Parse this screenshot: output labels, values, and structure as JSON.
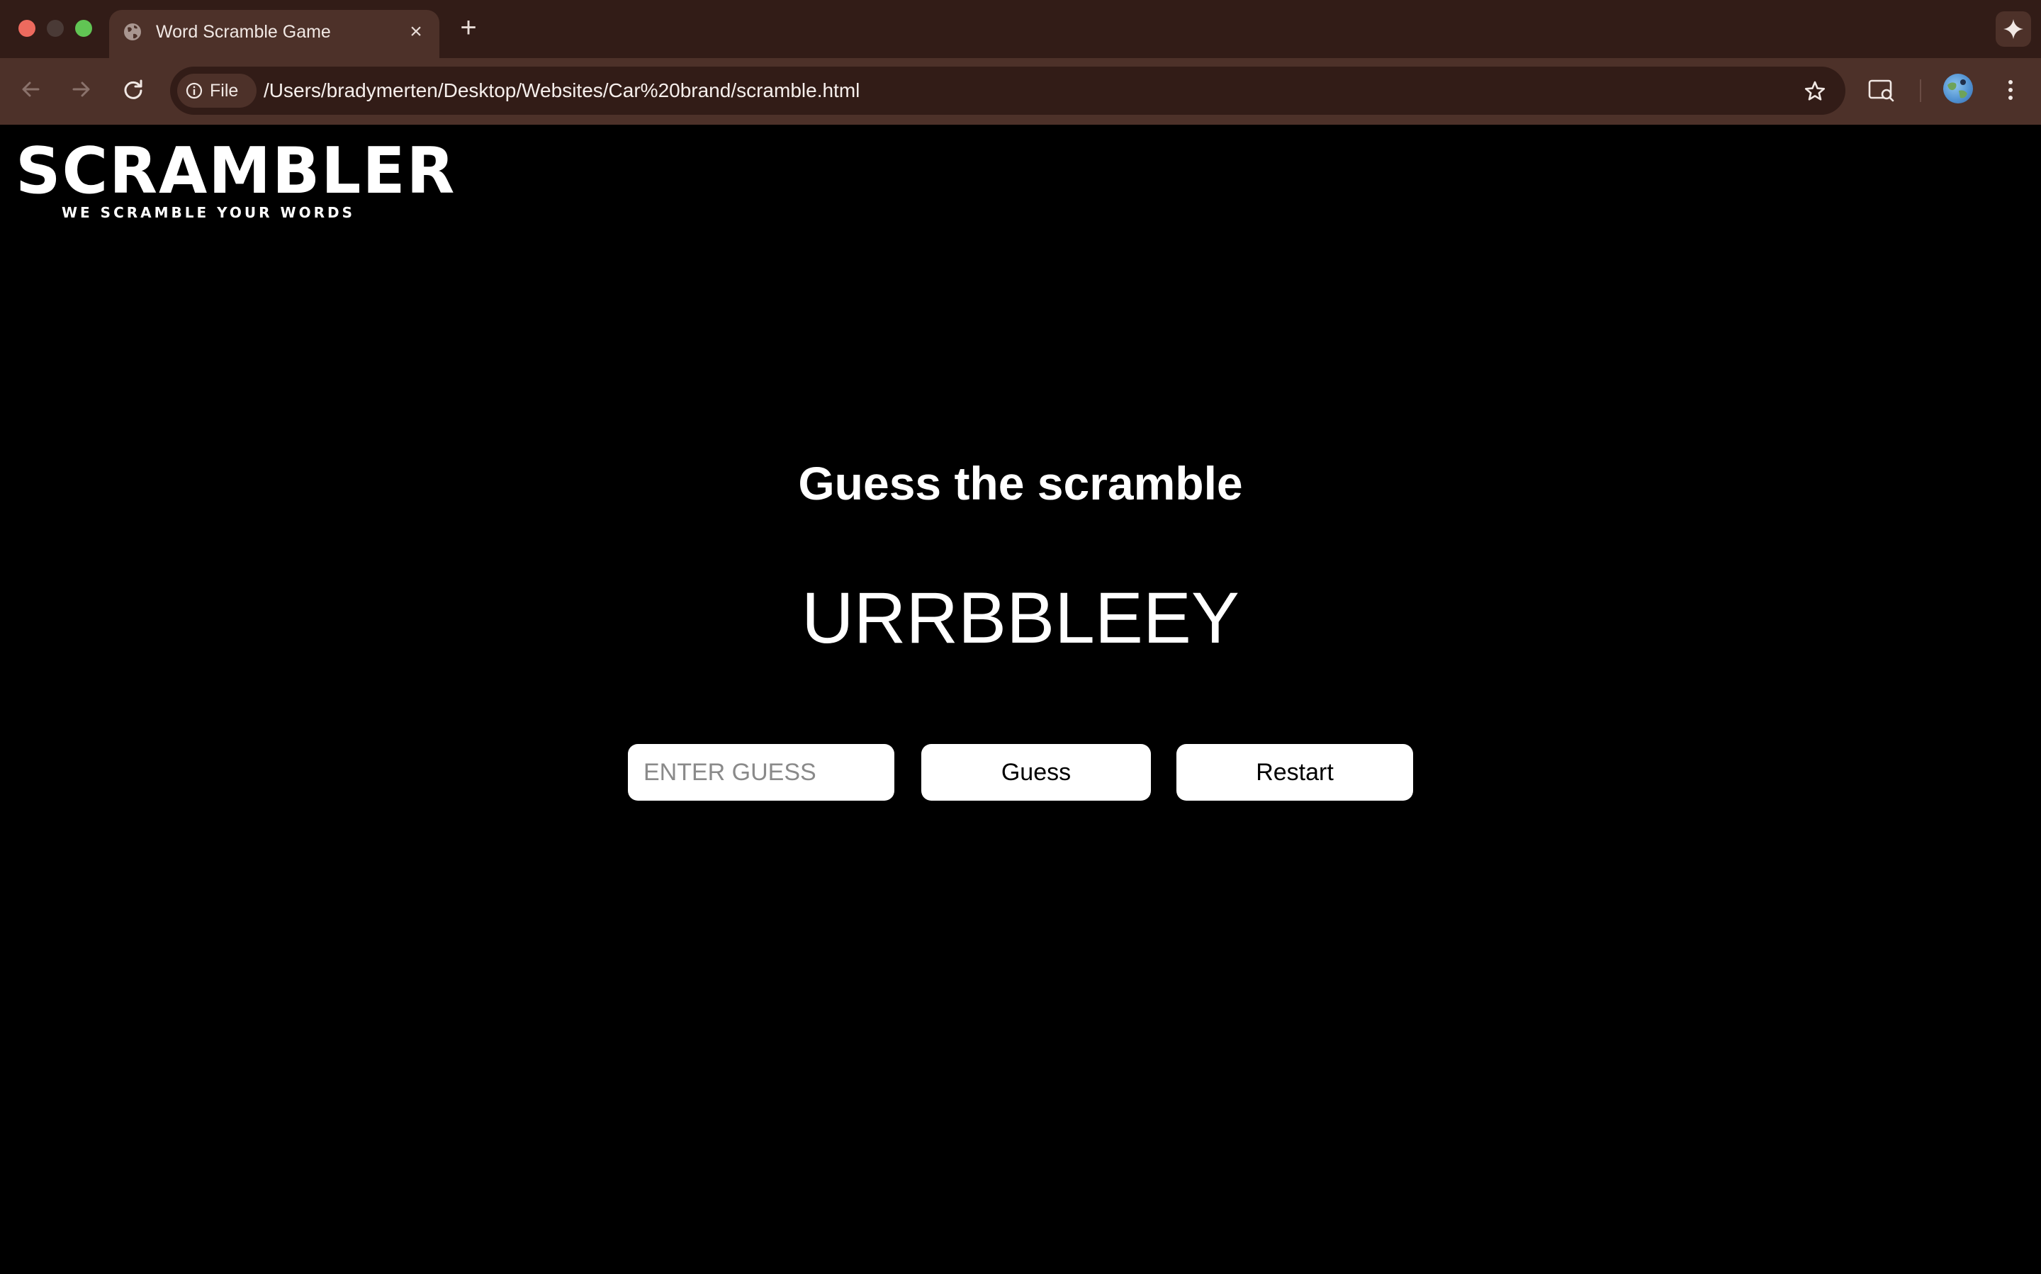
{
  "browser": {
    "tab": {
      "title": "Word Scramble Game",
      "close_glyph": "×"
    },
    "new_tab_glyph": "+",
    "address_bar": {
      "chip_label": "File",
      "url": "/Users/bradymerten/Desktop/Websites/Car%20brand/scramble.html"
    },
    "icons": {
      "tab_favicon": "globe-icon",
      "back": "arrow-left-icon",
      "forward": "arrow-right-icon",
      "reload": "reload-icon",
      "info": "info-icon",
      "bookmark": "star-icon",
      "google_lens": "search-lens-icon",
      "profile": "avatar",
      "menu": "kebab-menu-icon",
      "gemini": "sparkle-icon"
    },
    "colors": {
      "tabstrip": "#321c17",
      "toolbar": "#4d3129",
      "close": "#ed6a5e",
      "maximize": "#61c554"
    }
  },
  "page": {
    "logo": {
      "title": "SCRAMBLER",
      "tagline": "WE SCRAMBLE YOUR WORDS"
    },
    "heading": "Guess the scramble",
    "scrambled_word": "URRBBLEEY",
    "guess_input": {
      "placeholder": "ENTER GUESS",
      "value": ""
    },
    "buttons": {
      "guess": "Guess",
      "restart": "Restart"
    },
    "colors": {
      "background": "#000000",
      "text": "#ffffff",
      "controls": "#ffffff"
    }
  }
}
